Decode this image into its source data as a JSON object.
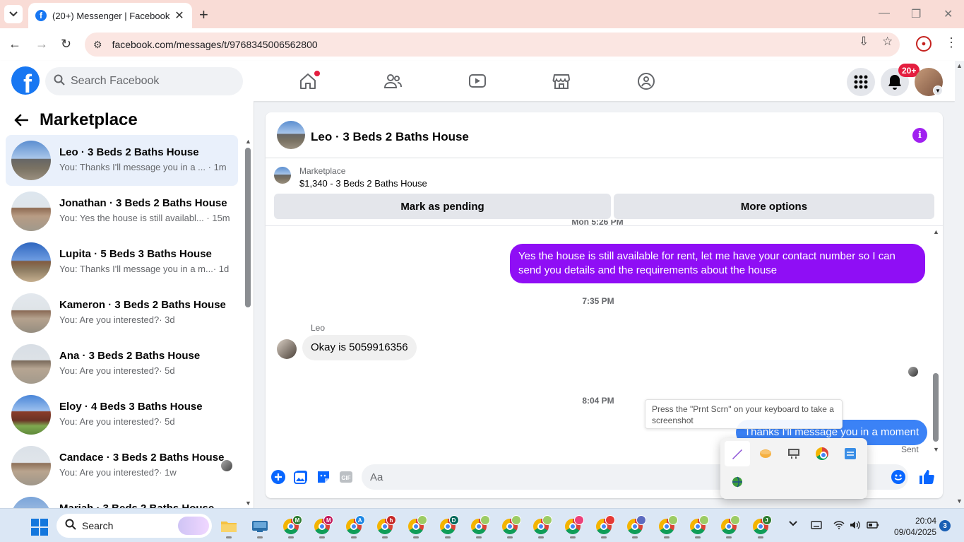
{
  "browser": {
    "tab_title": "(20+) Messenger | Facebook",
    "url": "facebook.com/messages/t/9768345006562800"
  },
  "fb_header": {
    "search_placeholder": "Search Facebook",
    "notification_badge": "20+"
  },
  "sidebar": {
    "title": "Marketplace",
    "conversations": [
      {
        "name": "Leo · 3 Beds 2 Baths House",
        "preview": "You: Thanks I'll message you in a ...",
        "time": "· 1m",
        "active": true
      },
      {
        "name": "Jonathan · 3 Beds 2 Baths House",
        "preview": "You: Yes the house is still availabl...",
        "time": "· 15m"
      },
      {
        "name": "Lupita · 5 Beds 3 Baths House",
        "preview": "You: Thanks I'll message you in a m...",
        "time": "· 1d"
      },
      {
        "name": "Kameron · 3 Beds 2 Baths House",
        "preview": "You: Are you interested?",
        "time": "· 3d"
      },
      {
        "name": "Ana · 3 Beds 2 Baths House",
        "preview": "You: Are you interested?",
        "time": "· 5d"
      },
      {
        "name": "Eloy · 4 Beds 3 Baths House",
        "preview": "You: Are you interested?",
        "time": "· 5d"
      },
      {
        "name": "Candace · 3 Beds 2 Baths House",
        "preview": "You: Are you interested?",
        "time": "· 1w"
      },
      {
        "name": "Mariah · 3 Beds 2 Baths House",
        "preview": "",
        "time": ""
      }
    ]
  },
  "chat": {
    "title": "Leo · 3 Beds 2 Baths House",
    "listing_label": "Marketplace",
    "listing_price": "$1,340 - 3 Beds 2 Baths House",
    "mark_pending_label": "Mark as pending",
    "more_options_label": "More options",
    "partial_timestamp": "Mon 5:26 PM",
    "messages": [
      {
        "from": "me",
        "text": "Yes the house is still available for rent, let me have your contact number so I can send you details and the requirements about the house"
      },
      {
        "timestamp": "7:35 PM"
      },
      {
        "from": "Leo",
        "text": "Okay is 5059916356"
      },
      {
        "timestamp": "8:04 PM"
      },
      {
        "from": "me",
        "text": "Thanks I'll message you in a moment"
      }
    ],
    "sender_name": "Leo",
    "status": "Sent",
    "composer_placeholder": "Aa"
  },
  "tooltip": "Press the \"Prnt Scrn\" on your keyboard to take a screenshot",
  "taskbar": {
    "search_placeholder": "Search",
    "time": "20:04",
    "date": "09/04/2025",
    "notification_count": "3",
    "chrome_profiles": [
      "M",
      "M",
      "A",
      "h",
      "",
      "D",
      "",
      "",
      "",
      "",
      "",
      "",
      "",
      "",
      "",
      "J"
    ]
  },
  "colors": {
    "accent": "#8f0ef5",
    "facebook_blue": "#1877f2",
    "badge_red": "#e41e3f"
  }
}
